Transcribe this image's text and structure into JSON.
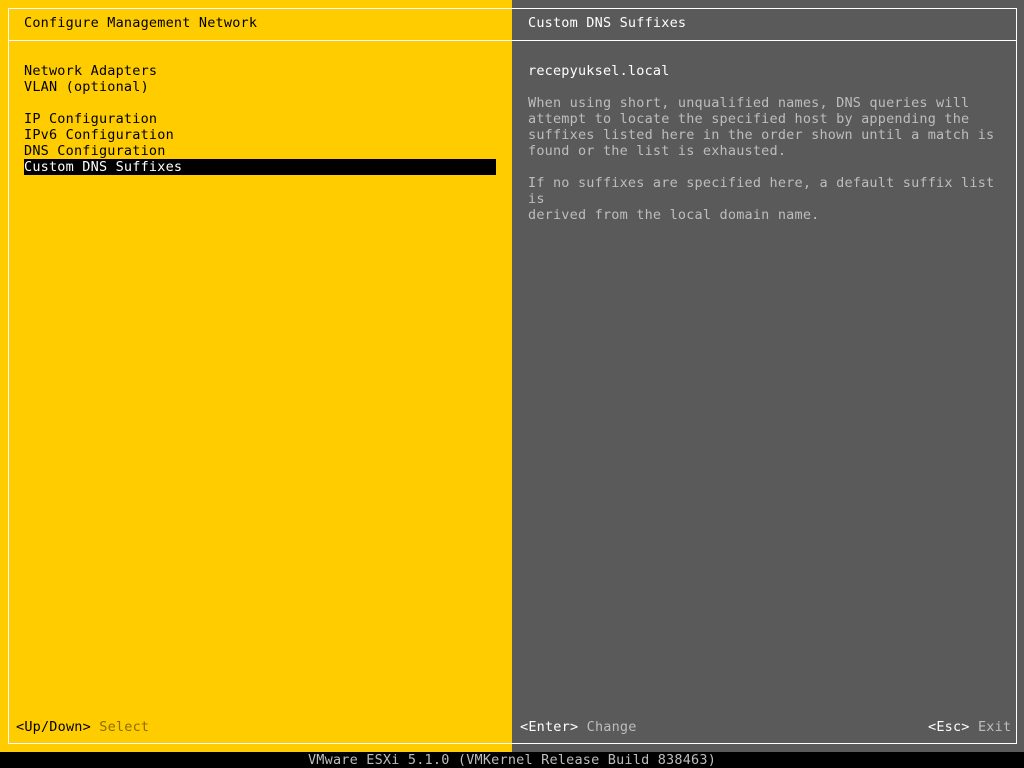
{
  "left_panel": {
    "title": "Configure Management Network",
    "menu_items": [
      {
        "label": "Network Adapters"
      },
      {
        "label": "VLAN (optional)"
      },
      {
        "label": "IP Configuration"
      },
      {
        "label": "IPv6 Configuration"
      },
      {
        "label": "DNS Configuration"
      },
      {
        "label": "Custom DNS Suffixes"
      }
    ],
    "selected_item": "Custom DNS Suffixes"
  },
  "right_panel": {
    "title": "Custom DNS Suffixes",
    "value": "recepyuksel.local",
    "description": [
      "When using short, unqualified names, DNS queries will\nattempt to locate the specified host by appending the\nsuffixes listed here in the order shown until a match is\nfound or the list is exhausted.",
      "If no suffixes are specified here, a default suffix list is\nderived from the local domain name."
    ]
  },
  "footer": {
    "nav_key": "<Up/Down>",
    "nav_action": "Select",
    "enter_key": "<Enter>",
    "enter_action": "Change",
    "esc_key": "<Esc>",
    "esc_action": "Exit"
  },
  "status_bar": {
    "text": "VMware ESXi 5.1.0 (VMKernel Release Build 838463)"
  },
  "colors": {
    "left_background": "#ffcc00",
    "right_background": "#5a5a5a",
    "selection_background": "#000000",
    "selection_text": "#ffffff"
  }
}
